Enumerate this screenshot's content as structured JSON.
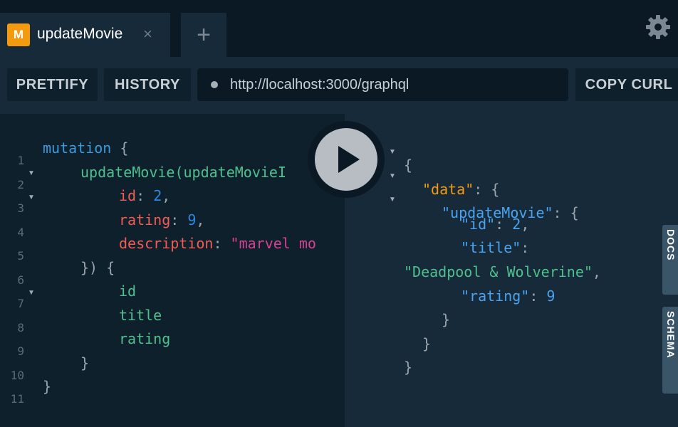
{
  "tab": {
    "badge": "M",
    "title": "updateMovie",
    "close": "×"
  },
  "new_tab": {
    "label": "+"
  },
  "settings": {
    "icon": "gear-icon"
  },
  "toolbar": {
    "prettify": "PRETTIFY",
    "history": "HISTORY",
    "url": "http://localhost:3000/graphql",
    "copy_curl": "COPY CURL"
  },
  "editor": {
    "line_numbers": [
      "1",
      "2",
      "3",
      "4",
      "5",
      "6",
      "7",
      "8",
      "9",
      "10",
      "11"
    ],
    "lines": {
      "l1": {
        "kw": "mutation",
        "rest": " {"
      },
      "l2": {
        "fn": "updateMovie",
        "rest": "(updateMovieI"
      },
      "l3": {
        "arg": "id",
        "sep": ": ",
        "val": "2",
        "end": ","
      },
      "l4": {
        "arg": "rating",
        "sep": ": ",
        "val": "9",
        "end": ","
      },
      "l5": {
        "arg": "description",
        "sep": ": ",
        "val": "\"marvel mo"
      },
      "l6": {
        "text": "}) {"
      },
      "l7": {
        "field": "id"
      },
      "l8": {
        "field": "title"
      },
      "l9": {
        "field": "rating"
      },
      "l10": {
        "text": "}"
      },
      "l11": {
        "text": "}"
      }
    }
  },
  "result": {
    "open": "{",
    "data_key": "\"data\"",
    "update_key": "\"updateMovie\"",
    "id_key": "\"id\"",
    "id_val": "2",
    "title_key": "\"title\"",
    "title_val": "\"Deadpool & Wolverine\"",
    "rating_key": "\"rating\"",
    "rating_val": "9",
    "colon": ": ",
    "brace_open": "{",
    "comma": ",",
    "close": "}"
  },
  "side_tabs": {
    "docs": "DOCS",
    "schema": "SCHEMA"
  },
  "play_button": {
    "icon": "play-icon"
  }
}
